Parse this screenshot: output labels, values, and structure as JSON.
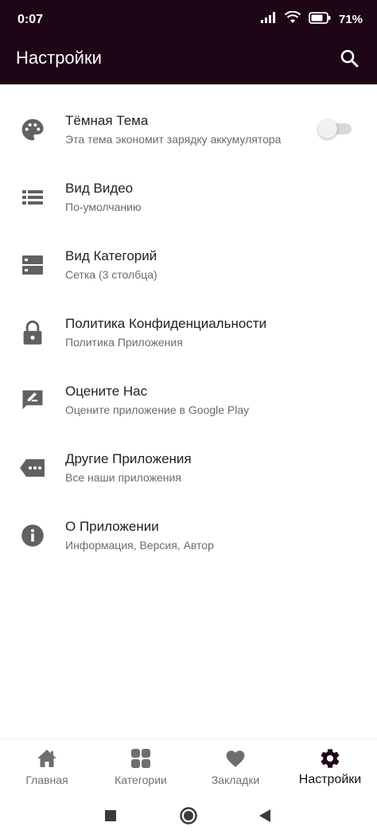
{
  "status_bar": {
    "time": "0:07",
    "battery_percent": "71",
    "battery_suffix": "%",
    "icons": [
      "signal-icon",
      "wifi-icon",
      "battery-icon"
    ]
  },
  "app_bar": {
    "title": "Настройки",
    "search_icon": "search-icon",
    "background": "#1f0617"
  },
  "settings": [
    {
      "icon": "palette-icon",
      "title": "Тёмная Тема",
      "subtitle": "Эта тема экономит зарядку аккумулятора",
      "toggle": {
        "checked": false
      }
    },
    {
      "icon": "list-view-icon",
      "title": "Вид Видео",
      "subtitle": "По-умолчанию"
    },
    {
      "icon": "grid-view-icon",
      "title": "Вид Категорий",
      "subtitle": "Сетка (3 столбца)"
    },
    {
      "icon": "lock-icon",
      "title": "Политика Конфиденциальности",
      "subtitle": "Политика Приложения"
    },
    {
      "icon": "rate-review-icon",
      "title": "Оцените Нас",
      "subtitle": "Оцените приложение в Google Play"
    },
    {
      "icon": "more-apps-icon",
      "title": "Другие Приложения",
      "subtitle": "Все наши приложения"
    },
    {
      "icon": "info-icon",
      "title": "О Приложении",
      "subtitle": "Информация, Версия, Автор"
    }
  ],
  "bottom_nav": {
    "items": [
      {
        "icon": "home-icon",
        "label": "Главная"
      },
      {
        "icon": "categories-icon",
        "label": "Категории"
      },
      {
        "icon": "heart-icon",
        "label": "Закладки"
      },
      {
        "icon": "gear-icon",
        "label": "Настройки",
        "active": true
      }
    ]
  },
  "system_nav": [
    "recents-icon",
    "home-circle-icon",
    "back-icon"
  ]
}
